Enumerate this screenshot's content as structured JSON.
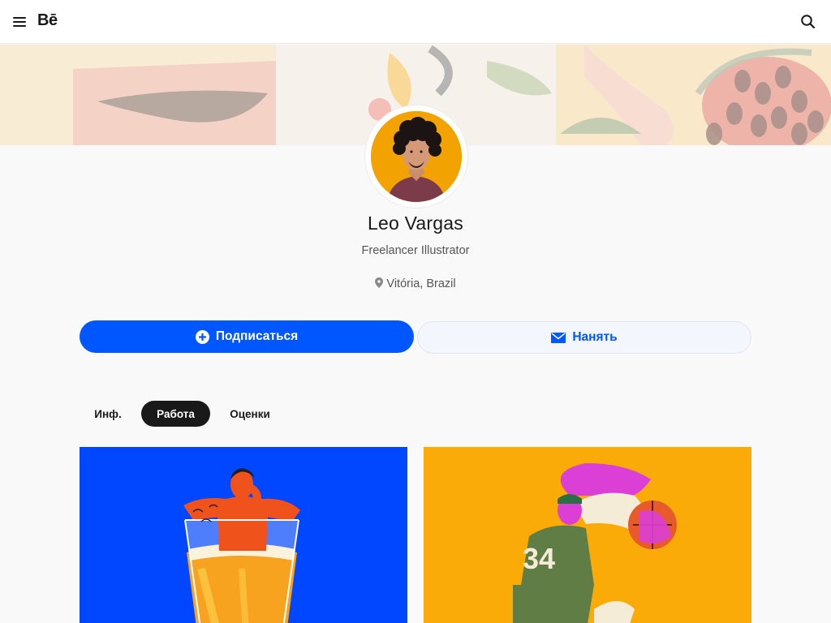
{
  "header": {
    "logo": "Bē",
    "menu_icon": "hamburger-menu-icon",
    "search_icon": "search-icon"
  },
  "profile": {
    "name": "Leo Vargas",
    "occupation": "Freelancer Illustrator",
    "location": "Vitória, Brazil",
    "location_icon": "map-pin-icon"
  },
  "actions": {
    "follow_label": "Подписаться",
    "follow_icon": "plus-circle-icon",
    "hire_label": "Нанять",
    "hire_icon": "mail-icon"
  },
  "tabs": [
    {
      "label": "Инф.",
      "active": false
    },
    {
      "label": "Работа",
      "active": true
    },
    {
      "label": "Оценки",
      "active": false
    }
  ],
  "colors": {
    "accent": "#0057ff",
    "active_tab": "#191919",
    "card_1_bg": "#0047ff",
    "card_2_bg": "#fbab07"
  }
}
